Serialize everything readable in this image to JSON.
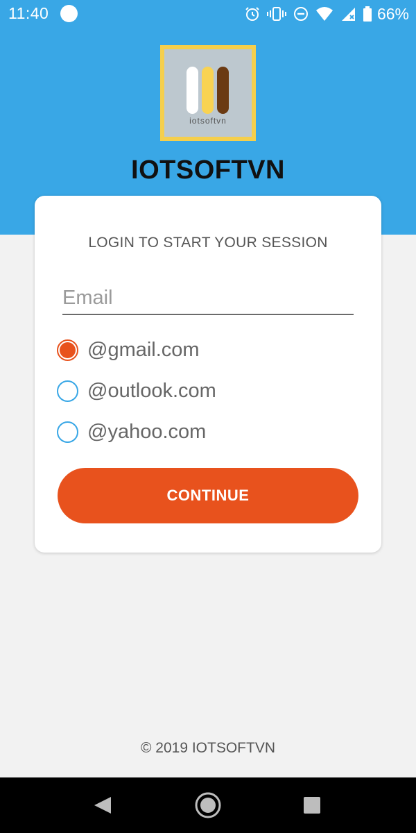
{
  "status_bar": {
    "time": "11:40",
    "battery": "66%",
    "icons": [
      "notification-dot",
      "alarm-icon",
      "vibrate-icon",
      "do-not-disturb-icon",
      "wifi-icon",
      "cell-signal-icon",
      "battery-icon"
    ]
  },
  "header": {
    "logo_text": "iotsoftvn",
    "app_title": "IOTSOFTVN"
  },
  "login": {
    "title": "LOGIN TO START YOUR SESSION",
    "email_placeholder": "Email",
    "email_value": "",
    "domains": [
      {
        "label": "@gmail.com",
        "selected": true
      },
      {
        "label": "@outlook.com",
        "selected": false
      },
      {
        "label": "@yahoo.com",
        "selected": false
      }
    ],
    "continue_label": "CONTINUE"
  },
  "footer": {
    "copyright": "© 2019 IOTSOFTVN"
  },
  "colors": {
    "header_blue": "#39a7e6",
    "accent_orange": "#e8521d",
    "logo_border": "#f5cf4c",
    "logo_bars": [
      "#ffffff",
      "#f9d352",
      "#6b3a12"
    ],
    "background": "#f2f2f2"
  },
  "nav_bar": {
    "icons": [
      "back-icon",
      "home-icon",
      "recents-icon"
    ]
  }
}
